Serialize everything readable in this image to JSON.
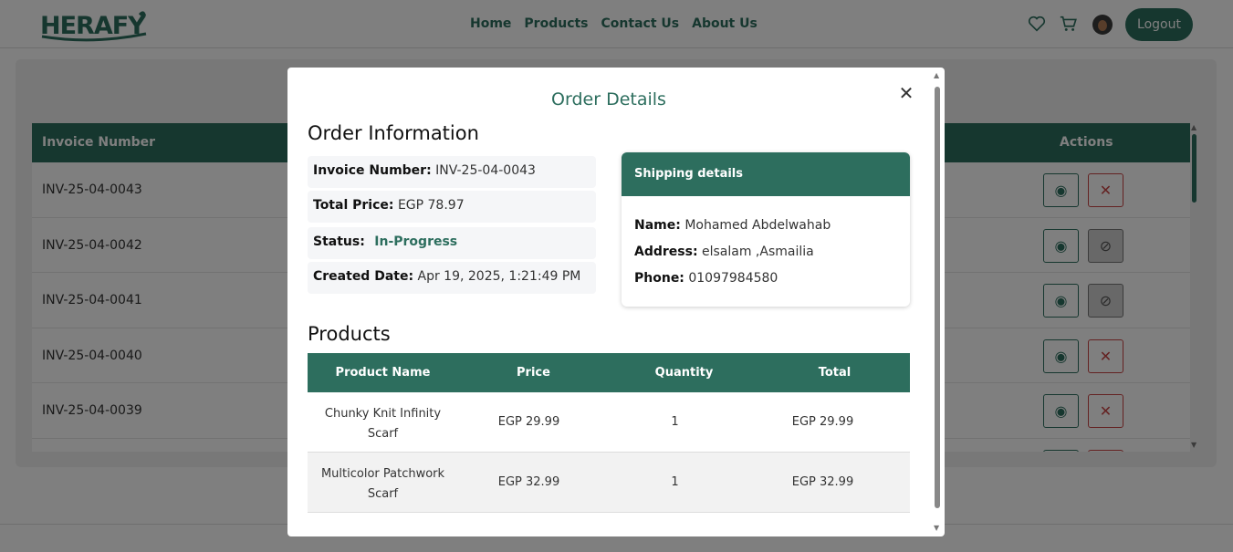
{
  "navbar": {
    "logo_text": "HERAFY",
    "links": [
      "Home",
      "Products",
      "Contact Us",
      "About Us"
    ],
    "logout_label": "Logout"
  },
  "orders": {
    "headers": {
      "invoice": "Invoice Number",
      "actions": "Actions"
    },
    "rows": [
      {
        "invoice": "INV-25-04-0043",
        "cancel_state": "cancel"
      },
      {
        "invoice": "INV-25-04-0042",
        "cancel_state": "disabled"
      },
      {
        "invoice": "INV-25-04-0041",
        "cancel_state": "disabled"
      },
      {
        "invoice": "INV-25-04-0040",
        "cancel_state": "cancel"
      },
      {
        "invoice": "INV-25-04-0039",
        "cancel_state": "cancel"
      }
    ]
  },
  "modal": {
    "title": "Order Details",
    "order_info": {
      "heading": "Order Information",
      "invoice_label": "Invoice Number:",
      "invoice_value": "INV-25-04-0043",
      "total_label": "Total Price:",
      "total_value": "EGP 78.97",
      "status_label": "Status:",
      "status_value": "In-Progress",
      "date_label": "Created Date:",
      "date_value": "Apr 19, 2025, 1:21:49 PM"
    },
    "shipping": {
      "heading": "Shipping details",
      "name_label": "Name:",
      "name_value": "Mohamed Abdelwahab",
      "address_label": "Address:",
      "address_value": "elsalam ,Asmailia",
      "phone_label": "Phone:",
      "phone_value": "01097984580"
    },
    "products": {
      "heading": "Products",
      "headers": [
        "Product Name",
        "Price",
        "Quantity",
        "Total"
      ],
      "rows": [
        {
          "name": "Chunky Knit Infinity Scarf",
          "price": "EGP 29.99",
          "quantity": "1",
          "total": "EGP 29.99"
        },
        {
          "name": "Multicolor Patchwork Scarf",
          "price": "EGP 32.99",
          "quantity": "1",
          "total": "EGP 32.99"
        }
      ]
    }
  },
  "colors": {
    "brand": "#2d6e5e",
    "danger": "#c94545"
  },
  "icons": {
    "wishlist": "heart-icon",
    "cart": "cart-icon",
    "close": "close-icon",
    "view": "eye-icon",
    "cancel": "x-icon",
    "disabled": "ban-icon"
  }
}
